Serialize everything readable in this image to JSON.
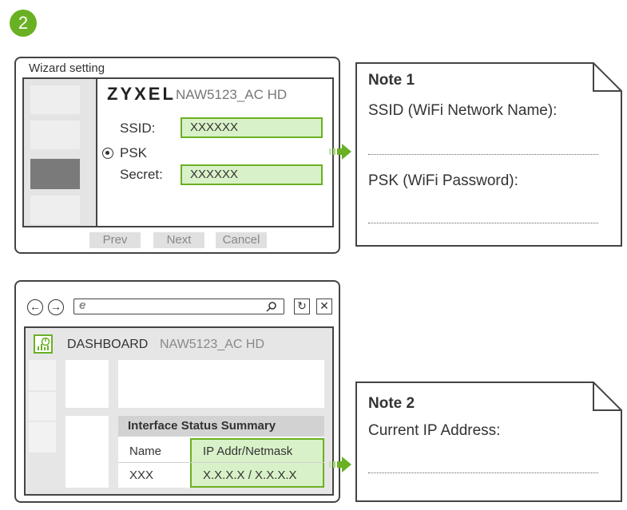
{
  "step_number": "2",
  "wizard": {
    "title": "Wizard setting",
    "brand": "ZYXEL",
    "model": "NAW5123_AC HD",
    "ssid_label": "SSID:",
    "ssid_value": "XXXXXX",
    "psk_label": "PSK",
    "secret_label": "Secret:",
    "secret_value": "XXXXXX",
    "buttons": {
      "prev": "Prev",
      "next": "Next",
      "cancel": "Cancel"
    }
  },
  "note1": {
    "title": "Note 1",
    "line1": "SSID (WiFi Network Name):",
    "line2": "PSK (WiFi Password):"
  },
  "browser": {
    "dashboard": "DASHBOARD",
    "model": "NAW5123_AC HD",
    "table_title": "Interface Status Summary",
    "headers": [
      "Name",
      "IP Addr/Netmask"
    ],
    "row": [
      "XXX",
      "X.X.X.X / X.X.X.X"
    ]
  },
  "note2": {
    "title": "Note 2",
    "line1": "Current IP Address:"
  },
  "colors": {
    "accent": "#6ab023",
    "field_bg": "#d9f1c8"
  },
  "icons": [
    "back-arrow-icon",
    "forward-arrow-icon",
    "ie-logo-icon",
    "search-icon",
    "refresh-icon",
    "close-icon",
    "dashboard-chart-icon",
    "radio-selected-icon",
    "right-arrow-icon"
  ]
}
